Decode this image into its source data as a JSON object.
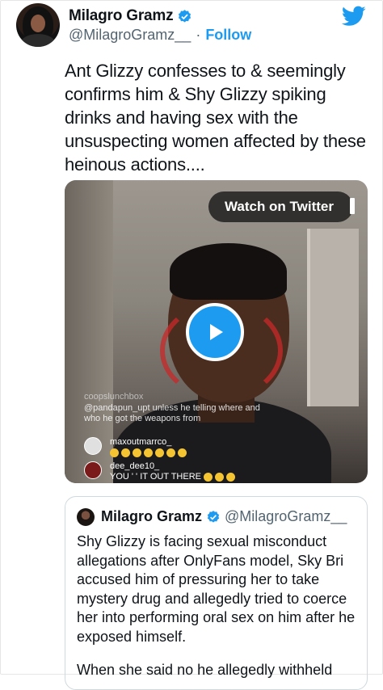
{
  "tweet": {
    "display_name": "Milagro Gramz",
    "handle": "@MilagroGramz__",
    "separator": "·",
    "follow_label": "Follow",
    "text": "Ant Glizzy confesses to & seemingly confirms him & Shy Glizzy spiking drinks and having sex with the unsuspecting women affected by these heinous actions....",
    "verified": true
  },
  "media": {
    "watch_label": "Watch on Twitter",
    "icon": "play-icon",
    "comments": {
      "faded_user": "coopslunchbox",
      "line1": "@pandapun_upt unless he telling where and",
      "line2": "who he got the weapons from",
      "row1_user": "maxoutmarrco_",
      "row2_user": "dee_dee10_",
      "row2_text": "YOU '          ' IT OUT THERE"
    }
  },
  "quote": {
    "display_name": "Milagro Gramz",
    "handle": "@MilagroGramz__",
    "text": "Shy Glizzy is facing sexual misconduct allegations after OnlyFans model, Sky Bri accused him of pressuring her to take mystery drug and allegedly tried to coerce her into performing oral sex on him after he exposed himself.",
    "text2": "When she said no he allegedly withheld"
  },
  "colors": {
    "accent": "#1d9bf0",
    "secondary_text": "#536471",
    "primary_text": "#0f1419"
  }
}
